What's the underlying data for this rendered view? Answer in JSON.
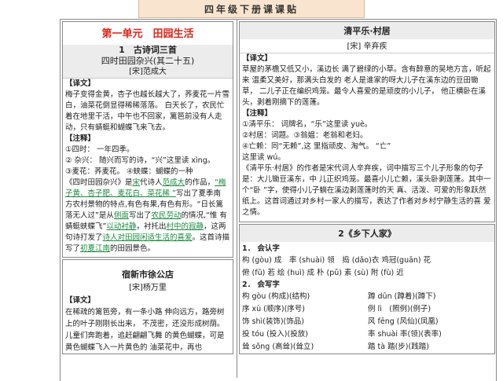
{
  "header": {
    "title": "四年级下册课课贴"
  },
  "left": {
    "unit_title": "第一单元　田园生活",
    "lesson": {
      "title": "1　古诗词三首",
      "poem_title": "四时田园杂兴(其二十五)",
      "author": "[宋]范成大"
    },
    "translation_head": "【译文】",
    "translation": "梅子变得金黄，杏子也越长越大了，荞麦花一片雪白，油菜花倒显得稀稀落落。 白天长了，农民忙着在地里干活，中午也不回家，篱笆前没有人走动，只有蜻蜓和蝴蝶飞来飞去。",
    "notes_head": "【注释】",
    "notes": [
      "①四时： 一年四季。",
      "② 杂兴： 随兴而写的诗，“兴”这里读 xìng。",
      "③麦花：荞麦花。 ④蛱蝶：蝴蝶的一种"
    ],
    "analysis": {
      "p1": "《四时田园杂兴》是",
      "g1": "宋",
      "p2": "代诗人",
      "g2": "范成大",
      "p3": "的作品，",
      "g3": "“梅子黄、杏子肥、麦花白、菜花稀 ”",
      "p4": "写出了夏季南 方农村景物的特点,有色有果,有色有形。“日长篱落无人过”是从",
      "g4": "侧面",
      "p5": "写出了",
      "g5": "农民劳动",
      "p6": "的情况,“惟 有蜻蜓蛱蝶飞”",
      "g6": "以动衬静",
      "p7": "，衬托出",
      "g7": "村中的寂静",
      "p8": "，这两句诗打发了",
      "g8": "诗人对田园闲适生活的喜爱",
      "p9": "。这首诗描写了",
      "g9": "初夏江南",
      "p10": "的田园景色。"
    },
    "poem2": {
      "title": "宿新市徐公店",
      "author": "[宋]杨万里"
    },
    "translation2_head": "【译文】",
    "translation2": "在稀疏的篱笆旁，有一条小路 伸向远方，路旁树上的叶子刚刚长出来， 不茂密，还没形成树荫。儿童们奔跑着，追赶翩翩飞舞 的黄色蝴蝶，可是黄色蝴蝶飞入一片黄色的 油菜花中，再也"
  },
  "right": {
    "poem_title": "清平乐·村居",
    "author": "[宋] 辛弃疾",
    "translation_head": "【译文】",
    "translation": "草屋的茅檐又低又小，溪边长 满了碧绿的小草。含有醉意的吴地方言，听起来 温柔又美好，那满头白发的 老人是谁家的呀大儿子在溪东边的豆田锄草， 二儿子正在编织鸡笼。最令人喜爱的是顽皮的小儿子， 他正横卧在溪头，剥着刚摘下的莲蓬。",
    "notes_head": "【注释】",
    "notes": [
      "①清平乐： 词牌名，“乐”这里读 yuè。",
      "②村居：词题。③翁媪：老翁和老妇。",
      "④亡赖：同“无赖”,这 里指顽皮、淘气。 “亡”",
      "这里读 wú。"
    ],
    "analysis": "《清平乐·村居》的作者是宋代词人辛弃疾，词中描写三个儿子形象的句子是：大儿锄豆溪东，中 儿正织鸡笼。最喜小儿亡赖，溪头卧剥莲蓬。其中一个“卧 ”字，使得小儿子躺在溪边剥莲蓬时的天 真、活泼、可爱的形象跃然纸上。这首词通过对乡村一家人的描写，表达了作者对乡村宁静生活的喜 爱之情。",
    "lesson2": {
      "title": "2《乡下人家》",
      "sec1_head": "1． 会认字",
      "sec1_lines": [
        "构 (gòu) 成　率 (shuài) 领　捣 (dǎo)衣 鸡冠(guān) 花",
        "俯 (fǔ) 若 绘 (huì) 成 朴 (pǔ) 素 (sù) 附 (fù) 近"
      ],
      "sec2_head": "2． 会写字",
      "sec2_rows": [
        [
          "构 gòu (构成)(结构)",
          "蹲 dūn (蹲着)(蹲下)"
        ],
        [
          "序 xù (顺序)(序号)",
          "例 lì　(照例)(例子)"
        ],
        [
          "饰 shì(装饰)(饰品)",
          "风 fēng (风仙)(凤凰)"
        ],
        [
          "投 tóu (投入)(投放)",
          "率 shuài 率(领)(表率)"
        ],
        [
          "耸 sǒng (高耸)(耸立)",
          "踏 tà 踏(步)(践踏)"
        ]
      ]
    }
  }
}
